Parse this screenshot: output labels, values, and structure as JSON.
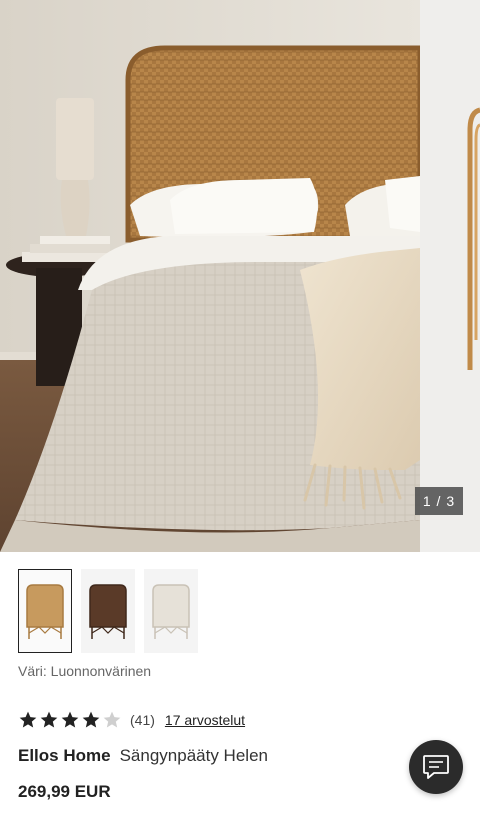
{
  "gallery": {
    "counter": "1 / 3",
    "current": 1,
    "total": 3
  },
  "swatches": [
    {
      "name": "Luonnonvärinen",
      "color": "#c79a5e",
      "selected": true
    },
    {
      "name": "Tumma",
      "color": "#5a3a28",
      "selected": false
    },
    {
      "name": "Valkoinen",
      "color": "#e6e1d8",
      "selected": false
    }
  ],
  "product": {
    "color_label": "Väri: Luonnonvärinen",
    "rating_value": 4,
    "rating_max": 5,
    "rating_count": "(41)",
    "reviews_link": "17 arvostelut",
    "brand": "Ellos Home",
    "name": "Sängynpääty Helen",
    "price": "269,99 EUR"
  },
  "chat": {
    "icon": "chat-bubble-icon"
  },
  "colors": {
    "star_filled": "#222222",
    "star_empty": "#cfcfcf",
    "chat_bg": "#2b2b2b"
  }
}
